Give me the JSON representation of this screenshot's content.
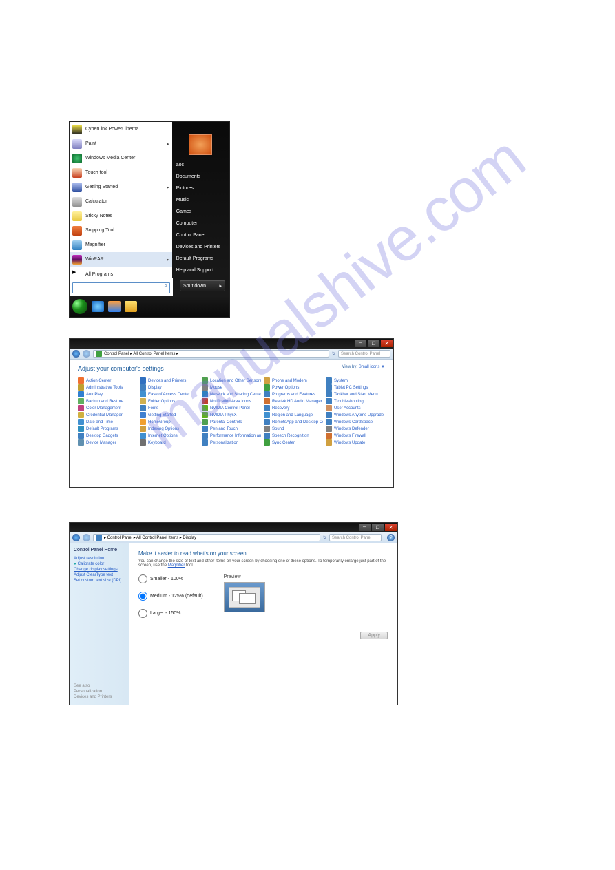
{
  "watermark": "manualshive.com",
  "start_menu": {
    "left_items": [
      {
        "label": "CyberLink PowerCinema",
        "icon_color": "linear-gradient(#f8e948,#222)",
        "arrow": false
      },
      {
        "label": "Paint",
        "icon_color": "linear-gradient(#d8d8f8,#8080c0)",
        "arrow": true
      },
      {
        "label": "Windows Media Center",
        "icon_color": "radial-gradient(#3fbf6f,#0a6a2a)",
        "arrow": false
      },
      {
        "label": "Touch tool",
        "icon_color": "linear-gradient(#f8d8b8,#c84020)",
        "arrow": false
      },
      {
        "label": "Getting Started",
        "icon_color": "linear-gradient(#b0c0f0,#3050a0)",
        "arrow": true
      },
      {
        "label": "Calculator",
        "icon_color": "linear-gradient(#e0e0e0,#909090)",
        "arrow": false
      },
      {
        "label": "Sticky Notes",
        "icon_color": "linear-gradient(#fff09a,#e8c840)",
        "arrow": false
      },
      {
        "label": "Snipping Tool",
        "icon_color": "linear-gradient(#f08040,#c04010)",
        "arrow": false
      },
      {
        "label": "Magnifier",
        "icon_color": "linear-gradient(#a0d0f0,#3080c0)",
        "arrow": false
      },
      {
        "label": "WinRAR",
        "icon_color": "linear-gradient(#c030c0,#601060,#f0a030)",
        "arrow": true,
        "highlight": true
      },
      {
        "label": "All Programs",
        "icon_color": "#000",
        "arrow": false,
        "allprogs": true,
        "arrow_icon": "▶"
      }
    ],
    "right_items": [
      "aoc",
      "Documents",
      "Pictures",
      "Music",
      "Games",
      "Computer",
      "Control Panel",
      "Devices and Printers",
      "Default Programs",
      "Help and Support"
    ],
    "search_placeholder": "",
    "shutdown_label": "Shut down",
    "taskbar_icons": [
      {
        "name": "ie-icon",
        "bg": "radial-gradient(#7ad0ff,#1060c0)"
      },
      {
        "name": "wmp-icon",
        "bg": "linear-gradient(#ffa040,#3080f0)"
      },
      {
        "name": "explorer-icon",
        "bg": "linear-gradient(#ffe070,#e0a020)"
      }
    ]
  },
  "control_panel": {
    "breadcrumb": "Control Panel ▸ All Control Panel Items ▸",
    "search_placeholder": "Search Control Panel",
    "title": "Adjust your computer's settings",
    "view_by": "View by:",
    "view_by_val": "Small icons ▼",
    "items": [
      {
        "l": "Action Center",
        "c": "#f07030"
      },
      {
        "l": "Administrative Tools",
        "c": "#c0a030"
      },
      {
        "l": "AutoPlay",
        "c": "#3080d0"
      },
      {
        "l": "Backup and Restore",
        "c": "#60b060"
      },
      {
        "l": "Color Management",
        "c": "#c04080"
      },
      {
        "l": "Credential Manager",
        "c": "#d0b040"
      },
      {
        "l": "Date and Time",
        "c": "#4090d0"
      },
      {
        "l": "Default Programs",
        "c": "#3090c0"
      },
      {
        "l": "Desktop Gadgets",
        "c": "#4080c0"
      },
      {
        "l": "Device Manager",
        "c": "#6090b0"
      },
      {
        "l": "Devices and Printers",
        "c": "#3070c0"
      },
      {
        "l": "Display",
        "c": "#4080c0"
      },
      {
        "l": "Ease of Access Center",
        "c": "#4090d0"
      },
      {
        "l": "Folder Options",
        "c": "#d0b050"
      },
      {
        "l": "Fonts",
        "c": "#4080c0"
      },
      {
        "l": "Getting Started",
        "c": "#4080d0"
      },
      {
        "l": "HomeGroup",
        "c": "#f0a030"
      },
      {
        "l": "Indexing Options",
        "c": "#d0a040"
      },
      {
        "l": "Internet Options",
        "c": "#4090d0"
      },
      {
        "l": "Keyboard",
        "c": "#707070"
      },
      {
        "l": "Location and Other Sensors",
        "c": "#50a050"
      },
      {
        "l": "Mouse",
        "c": "#808080"
      },
      {
        "l": "Network and Sharing Center",
        "c": "#3080c0"
      },
      {
        "l": "Notification Area Icons",
        "c": "#c04030"
      },
      {
        "l": "NVIDIA Control Panel",
        "c": "#60b020"
      },
      {
        "l": "NVIDIA PhysX",
        "c": "#60b020"
      },
      {
        "l": "Parental Controls",
        "c": "#50a050"
      },
      {
        "l": "Pen and Touch",
        "c": "#4080c0"
      },
      {
        "l": "Performance Information and Tools",
        "c": "#4080c0"
      },
      {
        "l": "Personalization",
        "c": "#4080c0"
      },
      {
        "l": "Phone and Modem",
        "c": "#d0a040"
      },
      {
        "l": "Power Options",
        "c": "#40a040"
      },
      {
        "l": "Programs and Features",
        "c": "#4080c0"
      },
      {
        "l": "Realtek HD Audio Manager",
        "c": "#d07030"
      },
      {
        "l": "Recovery",
        "c": "#4080c0"
      },
      {
        "l": "Region and Language",
        "c": "#4090d0"
      },
      {
        "l": "RemoteApp and Desktop Connections",
        "c": "#4080c0"
      },
      {
        "l": "Sound",
        "c": "#808080"
      },
      {
        "l": "Speech Recognition",
        "c": "#4080c0"
      },
      {
        "l": "Sync Center",
        "c": "#40a040"
      },
      {
        "l": "System",
        "c": "#4080c0"
      },
      {
        "l": "Tablet PC Settings",
        "c": "#4080c0"
      },
      {
        "l": "Taskbar and Start Menu",
        "c": "#4080c0"
      },
      {
        "l": "Troubleshooting",
        "c": "#4080c0"
      },
      {
        "l": "User Accounts",
        "c": "#d09060"
      },
      {
        "l": "Windows Anytime Upgrade",
        "c": "#4080c0"
      },
      {
        "l": "Windows CardSpace",
        "c": "#4080c0"
      },
      {
        "l": "Windows Defender",
        "c": "#808080"
      },
      {
        "l": "Windows Firewall",
        "c": "#d07030"
      },
      {
        "l": "Windows Update",
        "c": "#d0a040"
      }
    ]
  },
  "display": {
    "breadcrumb": "▸ Control Panel ▸ All Control Panel Items ▸ Display",
    "search_placeholder": "Search Control Panel",
    "side_title": "Control Panel Home",
    "side_links": [
      {
        "label": "Adjust resolution"
      },
      {
        "label": "Calibrate color",
        "bullet": true
      },
      {
        "label": "Change display settings",
        "selected": true
      },
      {
        "label": "Adjust ClearType text"
      },
      {
        "label": "Set custom text size (DPI)"
      }
    ],
    "see_also_title": "See also",
    "see_also": [
      "Personalization",
      "Devices and Printers"
    ],
    "main_title": "Make it easier to read what's on your screen",
    "main_desc_pre": "You can change the size of text and other items on your screen by choosing one of these options. To temporarily enlarge just part of the screen, use the ",
    "main_desc_link": "Magnifier",
    "main_desc_post": " tool.",
    "options": [
      {
        "label": "Smaller - 100%",
        "checked": false
      },
      {
        "label": "Medium - 125% (default)",
        "checked": true
      },
      {
        "label": "Larger - 150%",
        "checked": false
      }
    ],
    "preview_label": "Preview",
    "apply_label": "Apply"
  }
}
